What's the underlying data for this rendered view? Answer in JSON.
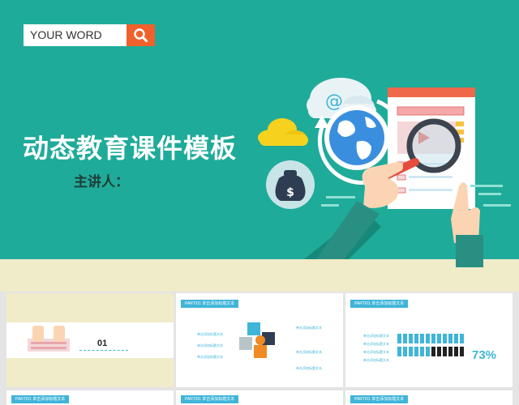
{
  "hero": {
    "search_placeholder": "YOUR WORD",
    "title": "动态教育课件模板",
    "presenter": "主讲人："
  },
  "thumbnails": [
    {
      "number": "01"
    },
    {
      "tag": "PART/01 单击添加标题文本",
      "caption": "单击添加标题文本"
    },
    {
      "tag": "PART/01 单击添加标题文本",
      "caption": "单击添加标题文本",
      "percent": "73%"
    },
    {
      "tag": "PART/01 单击添加标题文本"
    },
    {
      "tag": "PART/01 单击添加标题文本"
    },
    {
      "tag": "PART/01 单击添加标题文本"
    }
  ],
  "colors": {
    "hero_bg": "#1fab99",
    "accent": "#f0612c",
    "floor": "#f0ebc8",
    "blue": "#3fb5d8"
  }
}
